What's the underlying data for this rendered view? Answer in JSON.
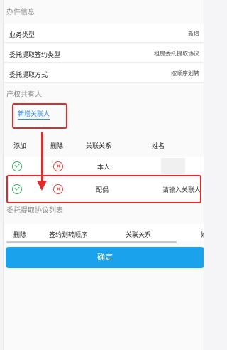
{
  "section_info": {
    "title": "办件信息",
    "rows": [
      {
        "label": "业务类型",
        "value": "新增"
      },
      {
        "label": "委托提取签约类型",
        "value": "租房委托提取协议"
      },
      {
        "label": "委托提取方式",
        "value": "按顺序划转"
      }
    ]
  },
  "section_owner": {
    "title": "产权共有人",
    "add_link": "新增关联人",
    "columns": [
      "添加",
      "删除",
      "关联关系",
      "姓名"
    ],
    "rows": [
      {
        "relation": "本人",
        "name": ""
      },
      {
        "relation": "配偶",
        "name_placeholder": "请输入关联人"
      }
    ]
  },
  "section_protocol": {
    "title": "委托提取协议列表",
    "columns": [
      "删除",
      "签约划转顺序",
      "关联关系",
      "姓"
    ]
  },
  "confirm_label": "确定",
  "colors": {
    "accent": "#1aa2ec",
    "link": "#2f8cf3",
    "highlight": "#e12b2b",
    "check": "#3bb26a",
    "delete": "#e24848"
  },
  "icons": [
    "check-circle-icon",
    "x-circle-icon"
  ]
}
